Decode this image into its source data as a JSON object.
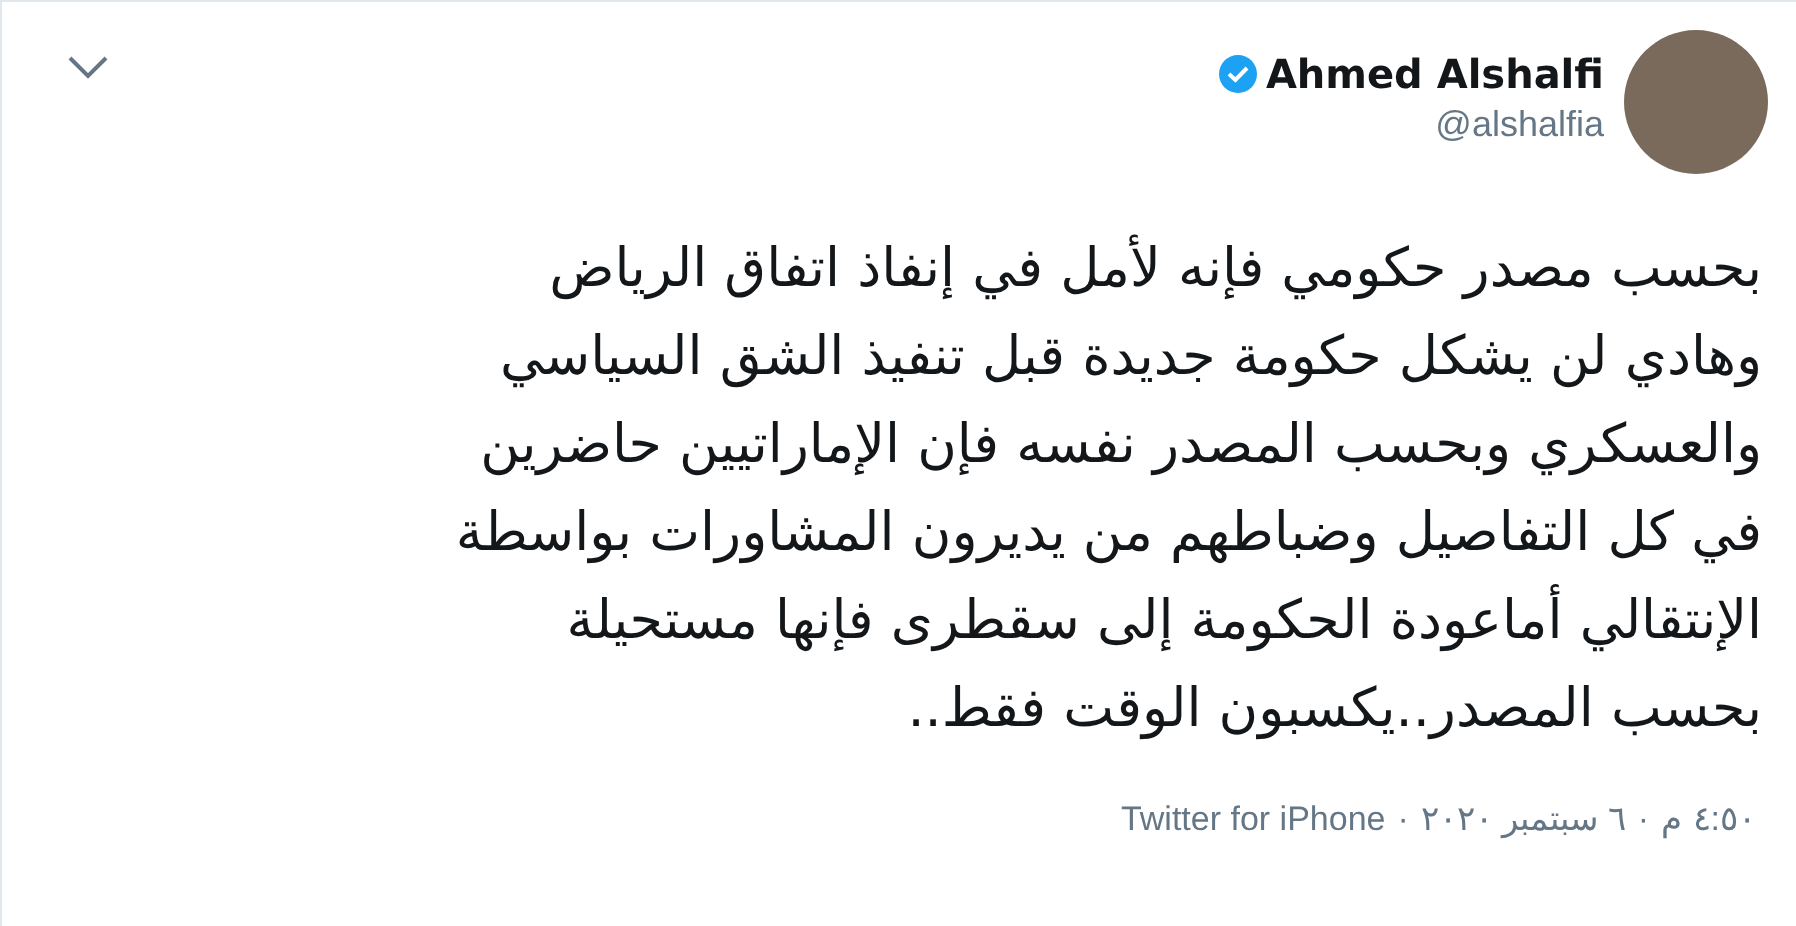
{
  "author": {
    "name": "Ahmed Alshalfi",
    "handle": "@alshalfia",
    "verified": true
  },
  "tweet_lines": [
    "بحسب مصدر حكومي فإنه لأمل في إنفاذ اتفاق الرياض",
    "وهادي لن يشكل حكومة جديدة قبل تنفيذ الشق السياسي",
    "والعسكري وبحسب المصدر نفسه فإن الإماراتيين حاضرين",
    "في كل التفاصيل وضباطهم من يديرون المشاورات بواسطة",
    "الإنتقالي أماعودة الحكومة إلى سقطرى فإنها مستحيلة",
    "بحسب المصدر..يكسبون الوقت فقط.."
  ],
  "footer": {
    "time": "٤:٥٠ م",
    "date": "٦ سبتمبر ٢٠٢٠",
    "source": "Twitter for iPhone",
    "separator": "·"
  }
}
